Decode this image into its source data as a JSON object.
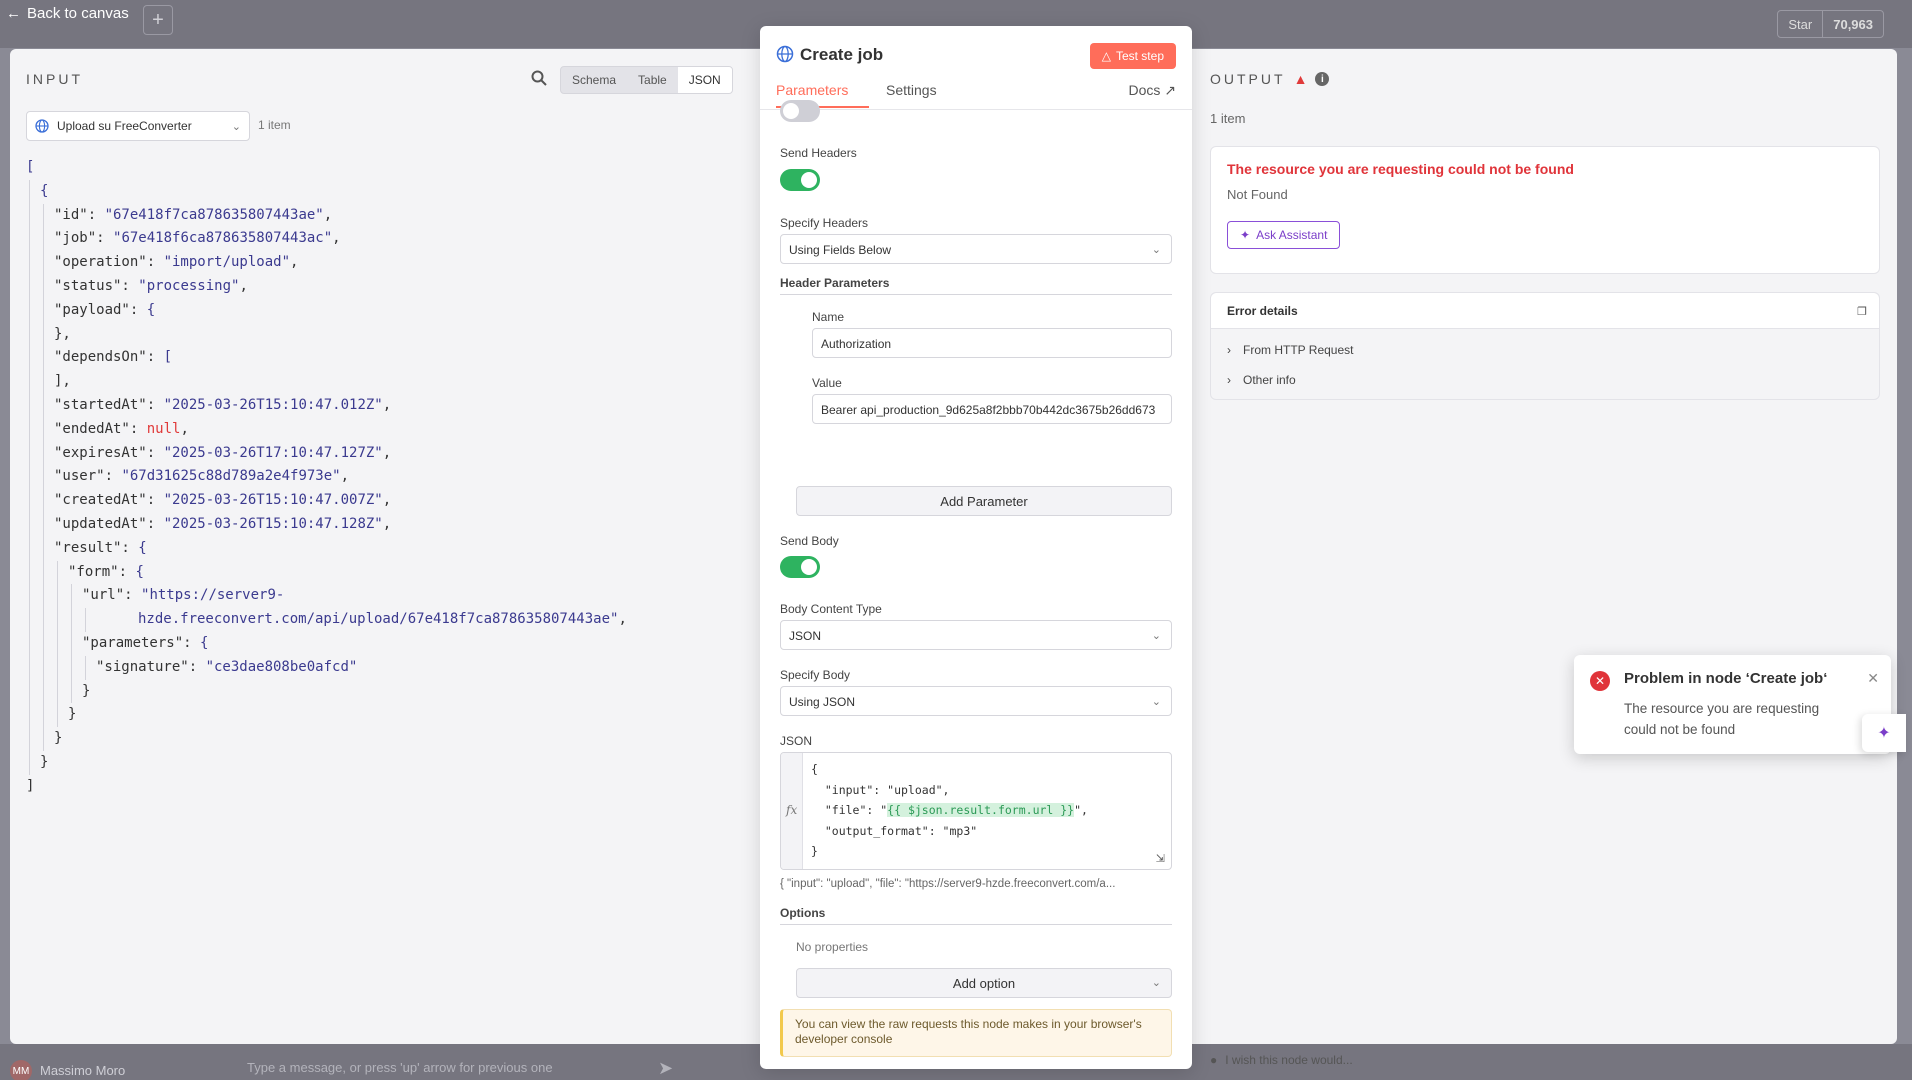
{
  "topbar": {
    "back_label": "Back to canvas",
    "star_label": "Star",
    "star_count": "70,963"
  },
  "bottombar": {
    "user_initials": "MM",
    "user_name": "Massimo Moro",
    "chat_placeholder": "Type a message, or press 'up' arrow for previous one"
  },
  "input": {
    "title": "INPUT",
    "views": [
      "Schema",
      "Table",
      "JSON"
    ],
    "active_view": "JSON",
    "node_select": "Upload su FreeConverter",
    "item_count": "1 item"
  },
  "json_lines": [
    {
      "indent": 0,
      "k": "",
      "v": "[",
      "t": "p"
    },
    {
      "indent": 1,
      "k": "",
      "v": "{",
      "t": "p"
    },
    {
      "indent": 2,
      "k": "\"id\": ",
      "v": "\"67e418f7ca878635807443ae\"",
      "t": "s",
      "c": ","
    },
    {
      "indent": 2,
      "k": "\"job\": ",
      "v": "\"67e418f6ca878635807443ac\"",
      "t": "s",
      "c": ","
    },
    {
      "indent": 2,
      "k": "\"operation\": ",
      "v": "\"import/upload\"",
      "t": "s",
      "c": ","
    },
    {
      "indent": 2,
      "k": "\"status\": ",
      "v": "\"processing\"",
      "t": "s",
      "c": ","
    },
    {
      "indent": 2,
      "k": "\"payload\": ",
      "v": "{",
      "t": "s"
    },
    {
      "indent": 2,
      "k": "",
      "v": "},",
      "t": "p"
    },
    {
      "indent": 2,
      "k": "\"dependsOn\": ",
      "v": "[",
      "t": "s"
    },
    {
      "indent": 2,
      "k": "",
      "v": "],",
      "t": "p"
    },
    {
      "indent": 2,
      "k": "\"startedAt\": ",
      "v": "\"2025-03-26T15:10:47.012Z\"",
      "t": "s",
      "c": ","
    },
    {
      "indent": 2,
      "k": "\"endedAt\": ",
      "v": "null",
      "t": "n",
      "c": ","
    },
    {
      "indent": 2,
      "k": "\"expiresAt\": ",
      "v": "\"2025-03-26T17:10:47.127Z\"",
      "t": "s",
      "c": ","
    },
    {
      "indent": 2,
      "k": "\"user\": ",
      "v": "\"67d31625c88d789a2e4f973e\"",
      "t": "s",
      "c": ","
    },
    {
      "indent": 2,
      "k": "\"createdAt\": ",
      "v": "\"2025-03-26T15:10:47.007Z\"",
      "t": "s",
      "c": ","
    },
    {
      "indent": 2,
      "k": "\"updatedAt\": ",
      "v": "\"2025-03-26T15:10:47.128Z\"",
      "t": "s",
      "c": ","
    },
    {
      "indent": 2,
      "k": "\"result\": ",
      "v": "{",
      "t": "s"
    },
    {
      "indent": 3,
      "k": "\"form\": ",
      "v": "{",
      "t": "s"
    },
    {
      "indent": 4,
      "k": "\"url\": ",
      "v": "\"https://server9-",
      "t": "s"
    },
    {
      "indent": 8,
      "k": "",
      "v": "hzde.freeconvert.com/api/upload/67e418f7ca878635807443ae\"",
      "t": "s",
      "c": ","
    },
    {
      "indent": 4,
      "k": "\"parameters\": ",
      "v": "{",
      "t": "s"
    },
    {
      "indent": 5,
      "k": "\"signature\": ",
      "v": "\"ce3dae808be0afcd\"",
      "t": "s"
    },
    {
      "indent": 4,
      "k": "",
      "v": "}",
      "t": "p"
    },
    {
      "indent": 3,
      "k": "",
      "v": "}",
      "t": "p"
    },
    {
      "indent": 2,
      "k": "",
      "v": "}",
      "t": "p"
    },
    {
      "indent": 1,
      "k": "",
      "v": "}",
      "t": "p"
    },
    {
      "indent": 0,
      "k": "",
      "v": "]",
      "t": "p"
    }
  ],
  "node": {
    "title": "Create job",
    "test_button": "Test step",
    "tabs": {
      "parameters": "Parameters",
      "settings": "Settings",
      "docs": "Docs"
    },
    "send_headers_label": "Send Headers",
    "send_headers_on": true,
    "specify_headers_label": "Specify Headers",
    "specify_headers_value": "Using Fields Below",
    "header_params_label": "Header Parameters",
    "name_label": "Name",
    "name_value": "Authorization",
    "value_label": "Value",
    "value_value": "Bearer api_production_9d625a8f2bbb70b442dc3675b26dd673",
    "add_parameter": "Add Parameter",
    "send_body_label": "Send Body",
    "send_body_on": true,
    "body_content_type_label": "Body Content Type",
    "body_content_type_value": "JSON",
    "specify_body_label": "Specify Body",
    "specify_body_value": "Using JSON",
    "json_label": "JSON",
    "fx": "fx",
    "code": {
      "l1": "{",
      "l2": "  \"input\": \"upload\",",
      "l3_pre": "  \"file\": \"",
      "l3_expr": "{{ $json.result.form.url }}",
      "l3_post": "\",",
      "l4": "  \"output_format\": \"mp3\"",
      "l5": "}"
    },
    "preview": "{   \"input\": \"upload\",   \"file\": \"https://server9-hzde.freeconvert.com/a...",
    "options_label": "Options",
    "no_properties": "No properties",
    "add_option": "Add option",
    "notice": "You can view the raw requests this node makes in your browser's developer console"
  },
  "output": {
    "title": "OUTPUT",
    "item_count": "1 item",
    "error_title": "The resource you are requesting could not be found",
    "error_sub": "Not Found",
    "ask_assistant": "Ask Assistant",
    "details_title": "Error details",
    "details_rows": [
      "From HTTP Request",
      "Other info"
    ],
    "wish": "I wish this node would..."
  },
  "toast": {
    "title": "Problem in node ‘Create job‘",
    "body": "The resource you are requesting could not be found"
  },
  "colors": {
    "accent": "#ff6d5a",
    "error": "#e0343a",
    "toggle_on": "#2eb360",
    "assistant": "#7b3ec9"
  }
}
